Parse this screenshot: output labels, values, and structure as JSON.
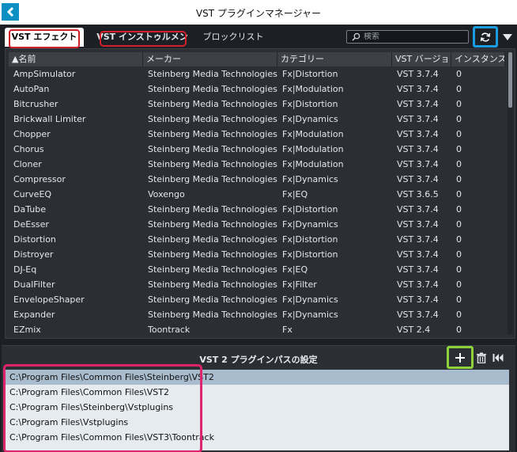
{
  "window": {
    "title": "VST プラグインマネージャー"
  },
  "tabs": [
    {
      "label": "VST エフェクト",
      "active": true
    },
    {
      "label": "VST インストゥルメント",
      "active": false
    },
    {
      "label": "ブロックリスト",
      "active": false
    }
  ],
  "search": {
    "placeholder": "検索",
    "value": ""
  },
  "table": {
    "columns": [
      "▲名前",
      "メーカー",
      "カテゴリー",
      "VST バージョン",
      "インスタンス数"
    ],
    "rows": [
      [
        "AmpSimulator",
        "Steinberg Media Technologies",
        "Fx|Distortion",
        "VST 3.7.4",
        "0"
      ],
      [
        "AutoPan",
        "Steinberg Media Technologies",
        "Fx|Modulation",
        "VST 3.7.4",
        "0"
      ],
      [
        "Bitcrusher",
        "Steinberg Media Technologies",
        "Fx|Distortion",
        "VST 3.7.4",
        "0"
      ],
      [
        "Brickwall Limiter",
        "Steinberg Media Technologies",
        "Fx|Dynamics",
        "VST 3.7.4",
        "0"
      ],
      [
        "Chopper",
        "Steinberg Media Technologies",
        "Fx|Modulation",
        "VST 3.7.4",
        "0"
      ],
      [
        "Chorus",
        "Steinberg Media Technologies",
        "Fx|Modulation",
        "VST 3.7.4",
        "0"
      ],
      [
        "Cloner",
        "Steinberg Media Technologies",
        "Fx|Modulation",
        "VST 3.7.4",
        "0"
      ],
      [
        "Compressor",
        "Steinberg Media Technologies",
        "Fx|Dynamics",
        "VST 3.7.4",
        "0"
      ],
      [
        "CurveEQ",
        "Voxengo",
        "Fx|EQ",
        "VST 3.6.5",
        "0"
      ],
      [
        "DaTube",
        "Steinberg Media Technologies",
        "Fx|Distortion",
        "VST 3.7.4",
        "0"
      ],
      [
        "DeEsser",
        "Steinberg Media Technologies",
        "Fx|Dynamics",
        "VST 3.7.4",
        "0"
      ],
      [
        "Distortion",
        "Steinberg Media Technologies",
        "Fx|Distortion",
        "VST 3.7.4",
        "0"
      ],
      [
        "Distroyer",
        "Steinberg Media Technologies",
        "Fx|Distortion",
        "VST 3.7.4",
        "0"
      ],
      [
        "DJ-Eq",
        "Steinberg Media Technologies",
        "Fx|EQ",
        "VST 3.7.4",
        "0"
      ],
      [
        "DualFilter",
        "Steinberg Media Technologies",
        "Fx|Filter",
        "VST 3.7.4",
        "0"
      ],
      [
        "EnvelopeShaper",
        "Steinberg Media Technologies",
        "Fx|Dynamics",
        "VST 3.7.4",
        "0"
      ],
      [
        "Expander",
        "Steinberg Media Technologies",
        "Fx|Dynamics",
        "VST 3.7.4",
        "0"
      ],
      [
        "EZmix",
        "Toontrack",
        "Fx",
        "VST 2.4",
        "0"
      ]
    ]
  },
  "paths": {
    "title": "VST 2 プラグインパスの設定",
    "items": [
      "C:\\Program Files\\Common Files\\Steinberg\\VST2",
      "C:\\Program Files\\Common Files\\VST2",
      "C:\\Program Files\\Steinberg\\Vstplugins",
      "C:\\Program Files\\Vstplugins",
      "C:\\Program Files\\Common Files\\VST3\\Toontrack"
    ],
    "selected_index": 0
  },
  "icons": {
    "app": "cubase-logo-icon",
    "search": "search-icon",
    "refresh": "refresh-icon",
    "menu": "dropdown-arrow-icon",
    "add": "plus-icon",
    "delete": "trash-icon",
    "reset": "skip-to-start-icon"
  },
  "colors": {
    "highlight_red": "#d4202a",
    "highlight_blue": "#1a9ce0",
    "highlight_green": "#8ed13b",
    "highlight_pink": "#e0236d"
  }
}
